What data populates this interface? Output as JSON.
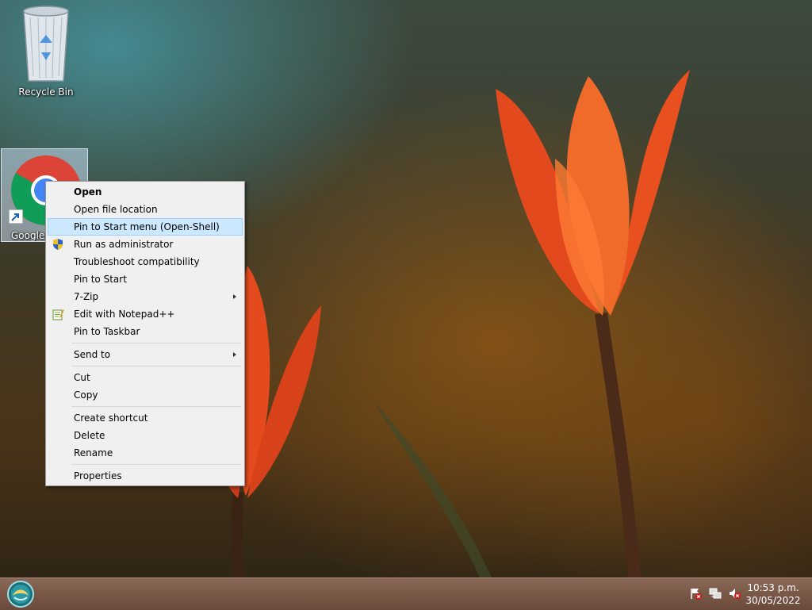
{
  "desktop": {
    "icons": [
      {
        "label": "Recycle Bin"
      },
      {
        "label": "Google Chrome"
      }
    ]
  },
  "context_menu": {
    "items": [
      {
        "label": "Open",
        "bold": true
      },
      {
        "label": "Open file location"
      },
      {
        "label": "Pin to Start menu (Open-Shell)",
        "highlighted": true
      },
      {
        "label": "Run as administrator",
        "icon": "uac-shield-icon"
      },
      {
        "label": "Troubleshoot compatibility"
      },
      {
        "label": "Pin to Start"
      },
      {
        "label": "7-Zip",
        "submenu": true
      },
      {
        "label": "Edit with Notepad++",
        "icon": "notepadpp-icon"
      },
      {
        "label": "Pin to Taskbar"
      },
      {
        "label": "Send to",
        "submenu": true
      },
      {
        "label": "Cut"
      },
      {
        "label": "Copy"
      },
      {
        "label": "Create shortcut"
      },
      {
        "label": "Delete"
      },
      {
        "label": "Rename"
      },
      {
        "label": "Properties"
      }
    ],
    "highlight_color": "#cce8ff"
  },
  "taskbar": {
    "start_icon": "open-shell-orb-icon",
    "tray_icons": [
      "action-center-flag-icon",
      "network-icon",
      "volume-muted-icon"
    ],
    "clock": {
      "time": "10:53 p.m.",
      "date": "30/05/2022"
    }
  }
}
